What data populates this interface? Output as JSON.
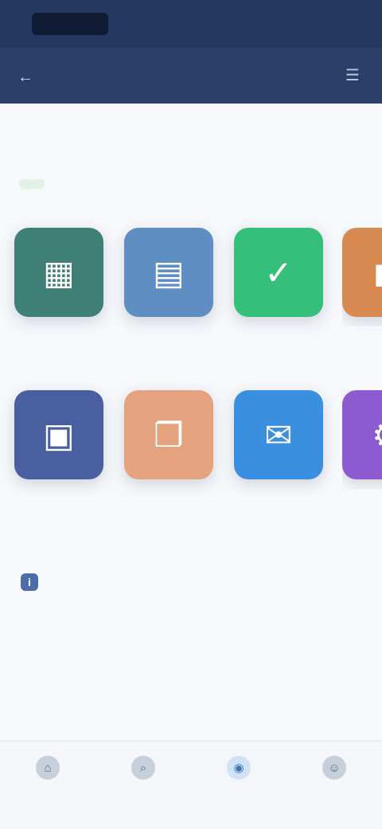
{
  "status_bar": {
    "time": "",
    "icons": ""
  },
  "header": {
    "title": "",
    "back_icon": "back-arrow-icon",
    "menu_icon": "menu-icon"
  },
  "main": {
    "section_title": "",
    "tiles": [
      {
        "label": "",
        "color": "#3f7f76",
        "icon": "grid-icon"
      },
      {
        "label": "",
        "color": "#5f8ec2",
        "icon": "chart-icon"
      },
      {
        "label": "",
        "color": "#36bf7b",
        "icon": "check-icon"
      },
      {
        "label": "",
        "color": "#d88b51",
        "icon": "box-icon"
      },
      {
        "label": "",
        "color": "#4a5fa0",
        "icon": "calendar-icon"
      },
      {
        "label": "",
        "color": "#e4a27f",
        "icon": "document-icon"
      },
      {
        "label": "",
        "color": "#3a8fe0",
        "icon": "message-icon"
      },
      {
        "label": "",
        "color": "#8b5bcf",
        "icon": "settings-icon"
      }
    ],
    "about": {
      "label": ""
    },
    "info_heading": "",
    "info_body": "",
    "info_heading_2": ""
  },
  "bottom_nav": {
    "items": [
      {
        "label": ""
      },
      {
        "label": ""
      },
      {
        "label": ""
      },
      {
        "label": ""
      }
    ]
  }
}
